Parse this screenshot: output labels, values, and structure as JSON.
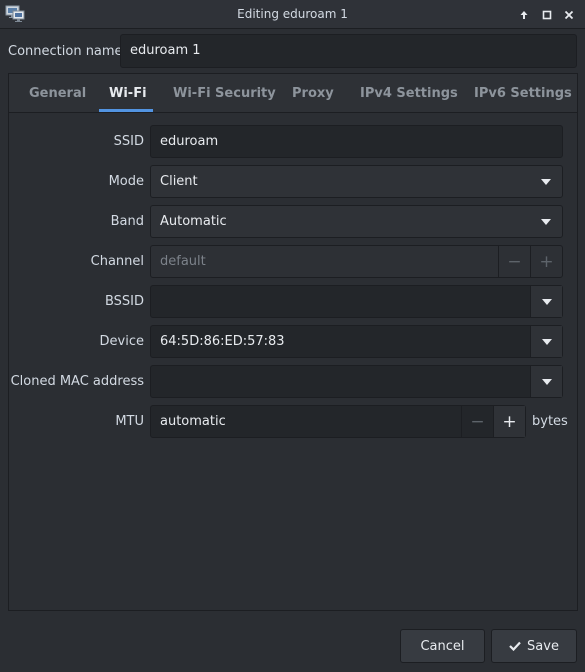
{
  "window": {
    "title": "Editing eduroam 1",
    "icon": "network-computer-icon"
  },
  "connection": {
    "label": "Connection name",
    "value": "eduroam 1"
  },
  "tabs": [
    {
      "label": "General"
    },
    {
      "label": "Wi-Fi"
    },
    {
      "label": "Wi-Fi Security"
    },
    {
      "label": "Proxy"
    },
    {
      "label": "IPv4 Settings"
    },
    {
      "label": "IPv6 Settings"
    }
  ],
  "active_tab": "Wi-Fi",
  "wifi": {
    "ssid": {
      "label": "SSID",
      "value": "eduroam"
    },
    "mode": {
      "label": "Mode",
      "value": "Client"
    },
    "band": {
      "label": "Band",
      "value": "Automatic"
    },
    "channel": {
      "label": "Channel",
      "value": "default",
      "minus": "−",
      "plus": "+"
    },
    "bssid": {
      "label": "BSSID",
      "value": ""
    },
    "device": {
      "label": "Device",
      "value": "64:5D:86:ED:57:83"
    },
    "cloned_mac": {
      "label": "Cloned MAC address",
      "value": ""
    },
    "mtu": {
      "label": "MTU",
      "value": "automatic",
      "minus": "−",
      "plus": "+",
      "unit": "bytes"
    }
  },
  "buttons": {
    "cancel": "Cancel",
    "save": "Save"
  },
  "colors": {
    "accent": "#5294e2",
    "background": "#2b2e33",
    "text": "#d3dae3"
  }
}
